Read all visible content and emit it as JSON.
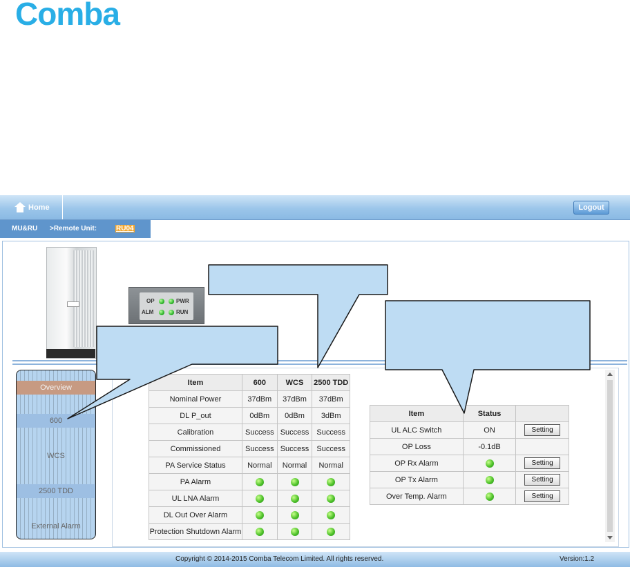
{
  "brand": {
    "logo_text": "Comba",
    "brand_color": "#29aee6"
  },
  "topbar": {
    "home_label": "Home",
    "logout_label": "Logout"
  },
  "breadcrumb": {
    "section": "MU&RU",
    "path": ">Remote Unit:",
    "unit": "RU04"
  },
  "device_leds": {
    "op": "OP",
    "pwr": "PWR",
    "alm": "ALM",
    "run": "RUN"
  },
  "nav": {
    "items": [
      "Overview",
      "600",
      "WCS",
      "2500 TDD",
      "External Alarm"
    ],
    "active_index": 0
  },
  "band_table": {
    "headers": [
      "Item",
      "600",
      "WCS",
      "2500 TDD"
    ],
    "rows": [
      {
        "label": "Nominal Power",
        "values": [
          "37dBm",
          "37dBm",
          "37dBm"
        ]
      },
      {
        "label": "DL P_out",
        "values": [
          "0dBm",
          "0dBm",
          "3dBm"
        ]
      },
      {
        "label": "Calibration",
        "values": [
          "Success",
          "Success",
          "Success"
        ]
      },
      {
        "label": "Commissioned",
        "values": [
          "Success",
          "Success",
          "Success"
        ]
      },
      {
        "label": "PA Service Status",
        "values": [
          "Normal",
          "Normal",
          "Normal"
        ]
      },
      {
        "label": "PA Alarm",
        "values": [
          "led-green",
          "led-green",
          "led-green"
        ]
      },
      {
        "label": "UL LNA Alarm",
        "values": [
          "led-green",
          "led-green",
          "led-green"
        ]
      },
      {
        "label": "DL Out Over Alarm",
        "values": [
          "led-green",
          "led-green",
          "led-green"
        ]
      },
      {
        "label": "Protection Shutdown Alarm",
        "values": [
          "led-green",
          "led-green",
          "led-green"
        ]
      }
    ]
  },
  "status_table": {
    "headers": [
      "Item",
      "Status",
      ""
    ],
    "rows": [
      {
        "label": "UL ALC Switch",
        "status": "ON",
        "button": "Setting"
      },
      {
        "label": "OP Loss",
        "status": "-0.1dB",
        "button": ""
      },
      {
        "label": "OP Rx Alarm",
        "status": "led-green",
        "button": "Setting"
      },
      {
        "label": "OP Tx Alarm",
        "status": "led-green",
        "button": "Setting"
      },
      {
        "label": "Over Temp. Alarm",
        "status": "led-green",
        "button": "Setting"
      }
    ]
  },
  "footer": {
    "copyright": "Copyright © 2014-2015 Comba Telecom Limited. All rights reserved.",
    "version": "Version:1.2"
  },
  "colors": {
    "accent": "#5f95cc",
    "callout_fill": "#bedcf3",
    "led_ok": "#3fbf2a"
  }
}
